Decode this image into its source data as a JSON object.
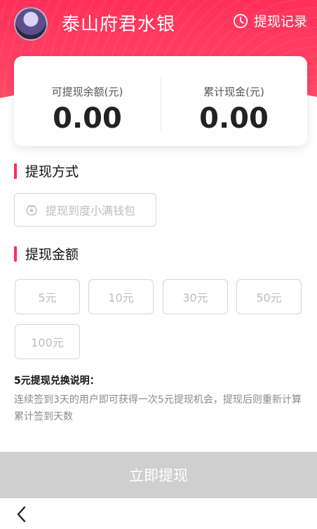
{
  "header": {
    "title": "泰山府君水银",
    "record_label": "提现记录"
  },
  "summary": {
    "withdrawable_label": "可提现余额(元)",
    "withdrawable_value": "0.00",
    "total_label": "累计现金(元)",
    "total_value": "0.00"
  },
  "method_section": {
    "title": "提现方式",
    "option_label": "提现到度小满钱包"
  },
  "amount_section": {
    "title": "提现金额",
    "options": [
      "5元",
      "10元",
      "30元",
      "50元",
      "100元"
    ]
  },
  "notes": {
    "title": "5元提现兑换说明：",
    "text": "连续签到3天的用户即可获得一次5元提现机会，提现后则重新计算累计签到天数"
  },
  "actions": {
    "submit_label": "立即提现"
  },
  "colors": {
    "accent": "#ff2f5a",
    "disabled_button": "#cfcfcf"
  },
  "icons": {
    "record": "clock-icon",
    "method": "wallet-icon",
    "back": "chevron-left-icon"
  }
}
